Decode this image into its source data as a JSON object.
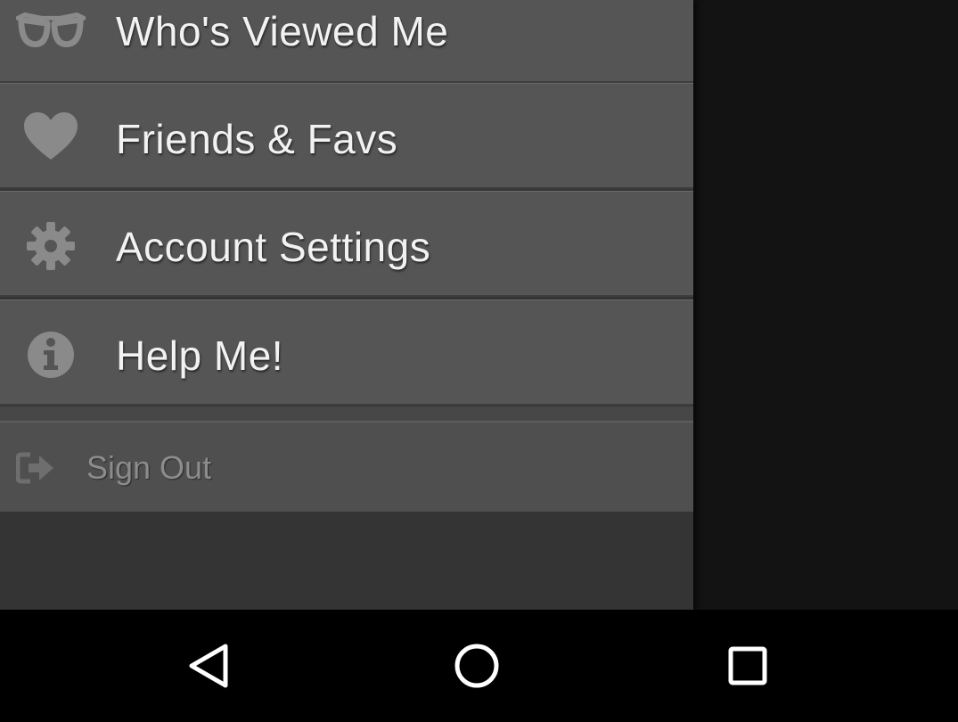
{
  "drawer": {
    "items": [
      {
        "label": "Who's Viewed Me",
        "icon": "glasses-icon"
      },
      {
        "label": "Friends & Favs",
        "icon": "heart-icon"
      },
      {
        "label": "Account Settings",
        "icon": "gear-icon"
      },
      {
        "label": "Help Me!",
        "icon": "info-icon"
      }
    ],
    "sign_out": {
      "label": "Sign Out",
      "icon": "sign-out-icon"
    }
  },
  "navbar": {
    "buttons": [
      {
        "name": "back",
        "icon": "back-triangle-icon"
      },
      {
        "name": "home",
        "icon": "home-circle-icon"
      },
      {
        "name": "recents",
        "icon": "recents-square-icon"
      }
    ]
  },
  "colors": {
    "drawer_item_bg": "#555555",
    "drawer_bg": "#343434",
    "app_bg": "#131313",
    "label_text": "#f2f2f2",
    "icon_color": "#8a8a8a",
    "signout_text": "#8c8c8c"
  }
}
